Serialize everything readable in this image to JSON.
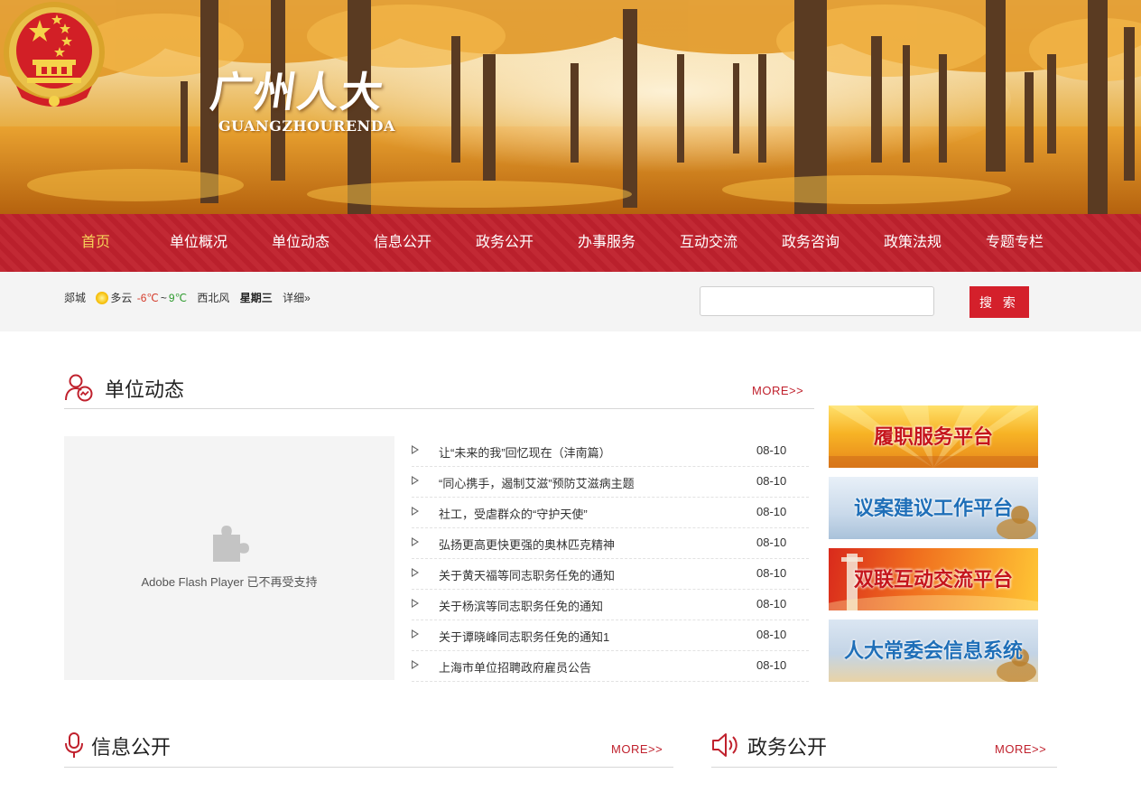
{
  "header": {
    "logo_title": "广州人大",
    "logo_subtitle": "GUANGZHOURENDA"
  },
  "nav": {
    "items": [
      {
        "label": "首页",
        "active": true
      },
      {
        "label": "单位概况"
      },
      {
        "label": "单位动态"
      },
      {
        "label": "信息公开"
      },
      {
        "label": "政务公开"
      },
      {
        "label": "办事服务"
      },
      {
        "label": "互动交流"
      },
      {
        "label": "政务咨询"
      },
      {
        "label": "政策法规"
      },
      {
        "label": "专题专栏"
      }
    ]
  },
  "weather": {
    "city": "郯城",
    "condition": "多云",
    "temp_low": "-6℃",
    "temp_sep": "~",
    "temp_high": "9℃",
    "wind": "西北风",
    "weekday": "星期三",
    "detail_link": "详细»"
  },
  "search": {
    "value": "",
    "button_label": "搜 索"
  },
  "sections": {
    "news": {
      "title": "单位动态",
      "more": "MORE>>"
    },
    "info": {
      "title": "信息公开",
      "more": "MORE>>"
    },
    "gov": {
      "title": "政务公开",
      "more": "MORE>>"
    }
  },
  "flash": {
    "message": "Adobe Flash Player 已不再受支持"
  },
  "news_list": [
    {
      "title": "让“未来的我”回忆现在（沣南篇）",
      "date": "08-10"
    },
    {
      "title": "“同心携手，遏制艾滋”预防艾滋病主题",
      "date": "08-10"
    },
    {
      "title": "社工，受虐群众的“守护天使”",
      "date": "08-10"
    },
    {
      "title": "弘扬更高更快更强的奥林匹克精神",
      "date": "08-10"
    },
    {
      "title": "关于黄天福等同志职务任免的通知",
      "date": "08-10"
    },
    {
      "title": "关于杨滨等同志职务任免的通知",
      "date": "08-10"
    },
    {
      "title": "关于谭晓峰同志职务任免的通知1",
      "date": "08-10"
    },
    {
      "title": "上海市单位招聘政府雇员公告",
      "date": "08-10"
    }
  ],
  "platforms": [
    {
      "label": "履职服务平台"
    },
    {
      "label": "议案建议工作平台"
    },
    {
      "label": "双联互动交流平台"
    },
    {
      "label": "人大常委会信息系统"
    }
  ],
  "colors": {
    "brand_red": "#c0212d",
    "nav_active": "#f7d25a",
    "search_button": "#d4202b"
  }
}
